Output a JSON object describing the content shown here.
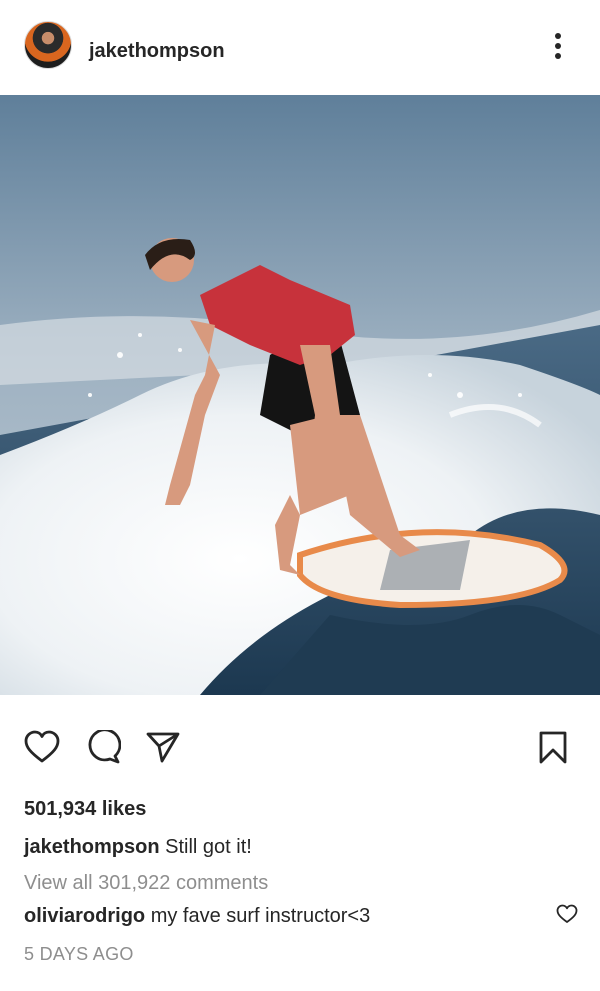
{
  "post": {
    "username": "jakethompson",
    "likes_text": "501,934 likes",
    "caption_user": "jakethompson",
    "caption_text": "Still got it!",
    "view_all_comments": "View all 301,922 comments",
    "comment": {
      "user": "oliviarodrigo",
      "text": "my fave surf instructor<3"
    },
    "time_ago": "5 DAYS AGO"
  },
  "icons": {
    "more": "more-options-icon",
    "like": "heart-icon",
    "comment": "comment-icon",
    "share": "share-icon",
    "save": "bookmark-icon",
    "comment_like": "heart-icon"
  },
  "colors": {
    "text": "#262626",
    "secondary": "#8e8e8e",
    "background": "#ffffff"
  }
}
